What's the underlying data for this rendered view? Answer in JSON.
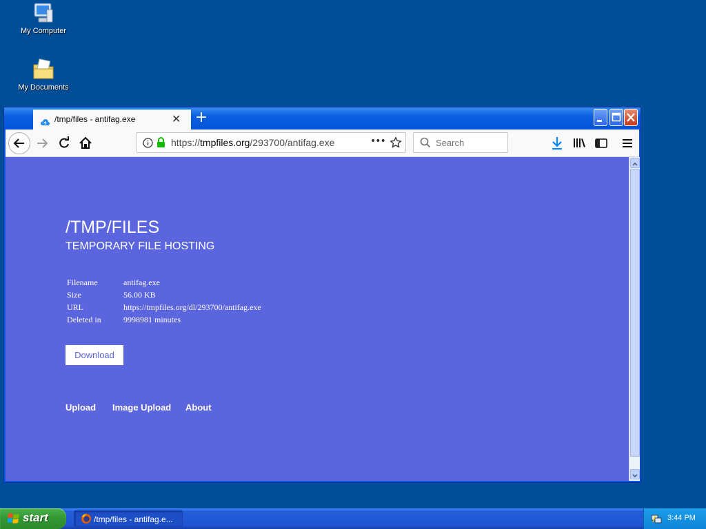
{
  "desktop": {
    "icons": [
      {
        "label": "My Computer"
      },
      {
        "label": "My Documents"
      }
    ]
  },
  "browser": {
    "tab": {
      "title": "/tmp/files - antifag.exe",
      "close": "✕"
    },
    "new_tab": "+",
    "address": {
      "prefix": "https://",
      "host": "tmpfiles.org",
      "path": "/293700/antifag.exe"
    },
    "page_actions": "•••",
    "search": {
      "placeholder": "Search"
    }
  },
  "page": {
    "title": "/TMP/FILES",
    "subtitle": "TEMPORARY FILE HOSTING",
    "info": [
      {
        "key": "Filename",
        "value": "antifag.exe"
      },
      {
        "key": "Size",
        "value": "56.00 KB"
      },
      {
        "key": "URL",
        "value": "https://tmpfiles.org/dl/293700/antifag.exe"
      },
      {
        "key": "Deleted in",
        "value": "9998981 minutes"
      }
    ],
    "download_label": "Download",
    "footer_links": [
      "Upload",
      "Image Upload",
      "About"
    ]
  },
  "taskbar": {
    "start_label": "start",
    "task_title": "/tmp/files - antifag.e...",
    "clock": "3:44 PM"
  },
  "colors": {
    "desktop": "#004e98",
    "page_background": "#5b65de",
    "accent_blue": "#0a84ff",
    "lock_green": "#12bc00"
  }
}
